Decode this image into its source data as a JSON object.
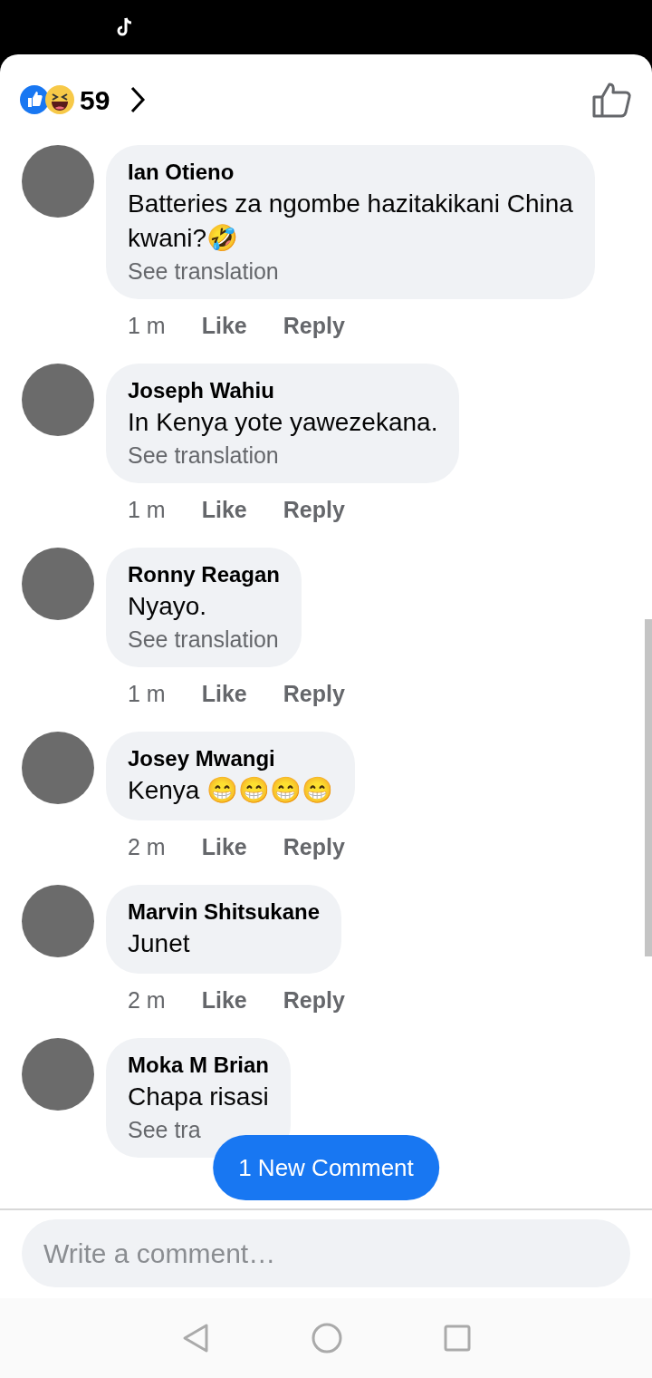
{
  "reactions": {
    "count": "59"
  },
  "comments": [
    {
      "name": "Ian Otieno",
      "text": "Batteries za ngombe hazitakikani China kwani?🤣",
      "translation": "See translation",
      "time": "1 m",
      "like": "Like",
      "reply": "Reply"
    },
    {
      "name": "Joseph Wahiu",
      "text": "In Kenya yote yawezekana.",
      "translation": "See translation",
      "time": "1 m",
      "like": "Like",
      "reply": "Reply"
    },
    {
      "name": "Ronny Reagan",
      "text": "Nyayo.",
      "translation": "See translation",
      "time": "1 m",
      "like": "Like",
      "reply": "Reply"
    },
    {
      "name": "Josey Mwangi",
      "text": "Kenya 😁😁😁😁",
      "time": "2 m",
      "like": "Like",
      "reply": "Reply"
    },
    {
      "name": "Marvin Shitsukane",
      "text": "Junet",
      "time": "2 m",
      "like": "Like",
      "reply": "Reply"
    },
    {
      "name": "Moka M Brian",
      "text": "Chapa risasi",
      "translation": "See tra"
    }
  ],
  "new_comment_button": "1 New Comment",
  "composer": {
    "placeholder": "Write a comment…"
  }
}
